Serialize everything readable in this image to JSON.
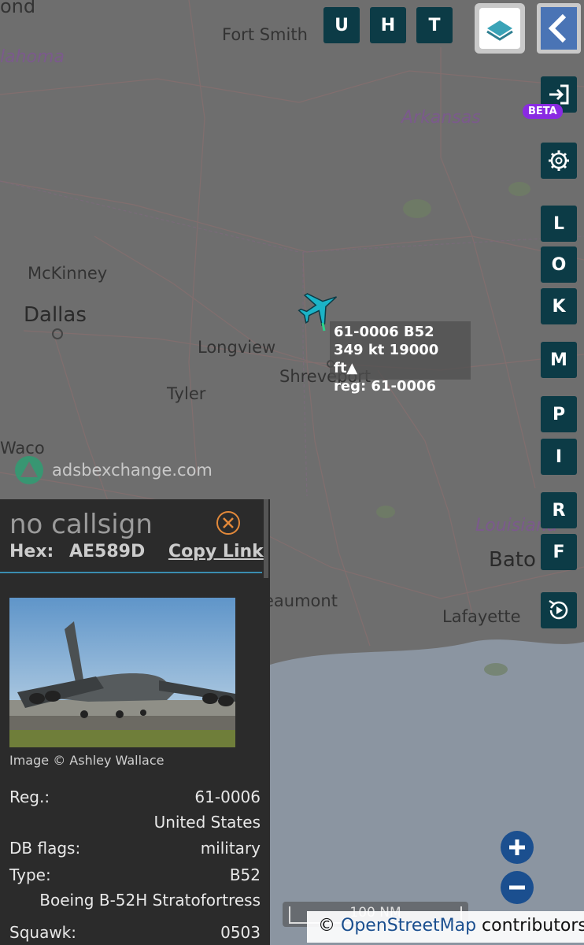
{
  "map": {
    "places": [
      {
        "name": "ond",
        "cls": "md"
      },
      {
        "name": "Fort Smith",
        "cls": "sm"
      },
      {
        "name": "lahoma",
        "cls": "state"
      },
      {
        "name": "Arkansas",
        "cls": "state"
      },
      {
        "name": "McKinney",
        "cls": "sm"
      },
      {
        "name": "Dallas",
        "cls": "lg"
      },
      {
        "name": "Longview",
        "cls": "sm"
      },
      {
        "name": "Shreveport",
        "cls": "sm"
      },
      {
        "name": "Tyler",
        "cls": "sm"
      },
      {
        "name": "Waco",
        "cls": "sm"
      },
      {
        "name": "Louisiana",
        "cls": "state"
      },
      {
        "name": "Bato",
        "cls": "lg"
      },
      {
        "name": "eaumont",
        "cls": "sm"
      },
      {
        "name": "Lafayette",
        "cls": "sm"
      }
    ],
    "watermark": "adsbexchange.com",
    "attribution_symbol": "©",
    "attribution_link": "OpenStreetMap",
    "attribution_suffix": "contributors.",
    "scale_label": "100 NM"
  },
  "aircraft_label": {
    "line1": "61-0006 B52",
    "line2": "349 kt  19000 ft▲",
    "line3": "reg: 61-0006"
  },
  "top_buttons": {
    "u": "U",
    "h": "H",
    "t": "T"
  },
  "side_buttons": {
    "l": "L",
    "o": "O",
    "k": "K",
    "m": "M",
    "p": "P",
    "i": "I",
    "r": "R",
    "f": "F"
  },
  "beta_badge": "BETA",
  "panel": {
    "callsign": "no callsign",
    "hex_label": "Hex:",
    "hex_value": "AE589D",
    "copy_link": "Copy Link",
    "image_credit": "Image © Ashley Wallace",
    "rows": {
      "reg_label": "Reg.:",
      "reg_value": "61-0006",
      "country": "United States",
      "dbflags_label": "DB flags:",
      "dbflags_value": "military",
      "type_label": "Type:",
      "type_value": "B52",
      "type_full": "Boeing B-52H Stratofortress",
      "squawk_label": "Squawk:",
      "squawk_value": "0503"
    }
  },
  "colors": {
    "button_bg": "#0c3b46",
    "beta_bg": "#8a2be2",
    "aircraft": "#1bb3c7",
    "zoom_buttons": "#1b4f8f"
  }
}
